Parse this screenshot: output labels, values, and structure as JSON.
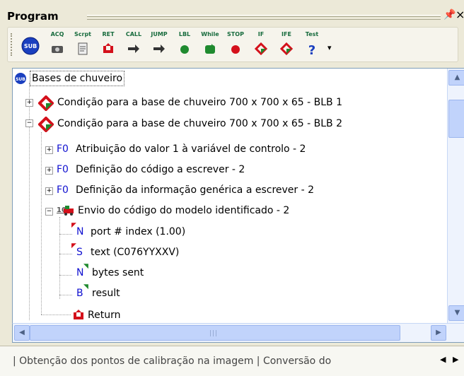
{
  "window": {
    "title": "Program",
    "pin_glyph": "⍑",
    "close_glyph": "×"
  },
  "toolbar": {
    "buttons": [
      {
        "label": "",
        "icon": "sub-icon"
      },
      {
        "label": "ACQ",
        "icon": "camera-icon"
      },
      {
        "label": "Scrpt",
        "icon": "script-icon"
      },
      {
        "label": "RET",
        "icon": "return-icon"
      },
      {
        "label": "CALL",
        "icon": "call-arrow-icon"
      },
      {
        "label": "JUMP",
        "icon": "jump-arrow-icon"
      },
      {
        "label": "LBL",
        "icon": "label-dot-icon"
      },
      {
        "label": "While",
        "icon": "while-loop-icon"
      },
      {
        "label": "STOP",
        "icon": "stop-icon"
      },
      {
        "label": "IF",
        "icon": "if-diamond-icon"
      },
      {
        "label": "IFE",
        "icon": "ife-diamond-icon"
      },
      {
        "label": "Test",
        "icon": "test-question-icon"
      }
    ],
    "overflow": "▾"
  },
  "tree": {
    "root": "Bases de chuveiro",
    "items": [
      {
        "text": "Condição para a base de chuveiro 700 x 700 x 65 - BLB 1"
      },
      {
        "text": "Condição para a base de chuveiro 700 x 700 x 65 - BLB 2"
      },
      {
        "text": "Atribuição do valor 1 à variável de controlo - 2",
        "tag": "F0"
      },
      {
        "text": "Definição do código a escrever - 2",
        "tag": "F0"
      },
      {
        "text": "Definição da informação genérica a escrever - 2",
        "tag": "F0"
      },
      {
        "text": "Envio do código do modelo identificado - 2",
        "tag": "10"
      },
      {
        "text": "port # index (1.00)",
        "tag": "N"
      },
      {
        "text": "text (C076YYXXV)",
        "tag": "S"
      },
      {
        "text": "bytes sent",
        "tag": "N"
      },
      {
        "text": "result",
        "tag": "B"
      },
      {
        "text": "Return"
      }
    ],
    "expander_plus": "+",
    "expander_minus": "−"
  },
  "scroll": {
    "up": "▲",
    "down": "▼",
    "left": "◀",
    "right": "▶",
    "grip": "|||"
  },
  "tabs": {
    "text": "| Obtenção dos pontos de calibração na imagem | Conversão do",
    "prev": "◀",
    "next": "▶"
  },
  "colors": {
    "accent": "#0b3ea8",
    "red": "#d4101b",
    "green": "#1f8a2f",
    "blue_text": "#1010d0"
  }
}
